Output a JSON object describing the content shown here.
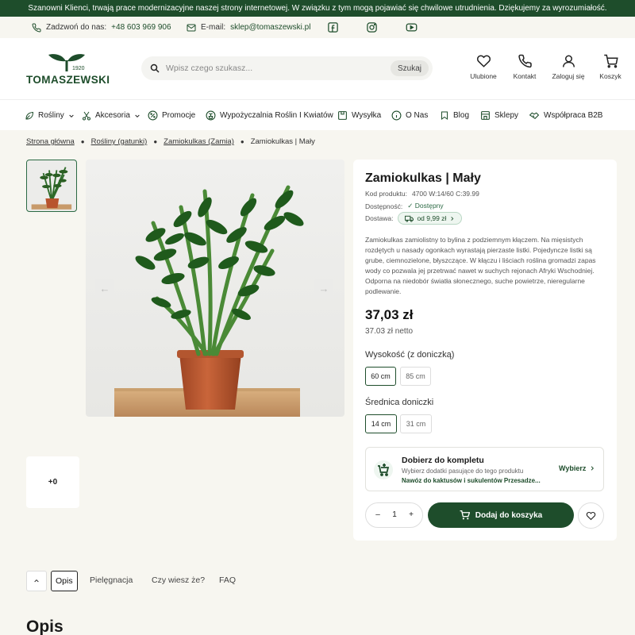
{
  "notice": "Szanowni Klienci, trwają prace modernizacyjne naszej strony internetowej. W związku z tym mogą pojawiać się chwilowe utrudnienia. Dziękujemy za wyrozumiałość.",
  "contact": {
    "phone_label": "Zadzwoń do nas:",
    "phone": "+48 603 969 906",
    "email_label": "E-mail:",
    "email": "sklep@tomaszewski.pl",
    "social_icons": [
      "facebook-icon",
      "instagram-icon",
      "youtube-icon"
    ]
  },
  "logo": {
    "text": "TOMASZEWSKI",
    "year": "1920"
  },
  "search": {
    "placeholder": "Wpisz czego szukasz...",
    "button": "Szukaj"
  },
  "header_icons": [
    {
      "label": "Ulubione",
      "icon": "heart-icon"
    },
    {
      "label": "Kontakt",
      "icon": "phone-icon"
    },
    {
      "label": "Zaloguj się",
      "icon": "user-icon"
    },
    {
      "label": "Koszyk",
      "icon": "cart-icon"
    }
  ],
  "nav": [
    {
      "label": "Rośliny",
      "icon": "leaf-icon",
      "dropdown": true
    },
    {
      "label": "Akcesoria",
      "icon": "scissors-icon",
      "dropdown": true
    },
    {
      "label": "Promocje",
      "icon": "percent-icon"
    },
    {
      "label": "Wypożyczalnia Roślin I Kwiatów",
      "icon": "plant-pot-icon"
    },
    {
      "label": "Wysyłka",
      "icon": "box-icon"
    },
    {
      "label": "O Nas",
      "icon": "info-icon"
    },
    {
      "label": "Blog",
      "icon": "bookmark-icon"
    },
    {
      "label": "Sklepy",
      "icon": "store-icon"
    },
    {
      "label": "Współpraca B2B",
      "icon": "handshake-icon"
    }
  ],
  "breadcrumb": [
    "Strona główna",
    "Rośliny (gatunki)",
    "Zamiokulkas (Zamia)",
    "Zamiokulkas | Mały"
  ],
  "gallery": {
    "more_label": "+0"
  },
  "product": {
    "title": "Zamiokulkas | Mały",
    "code_label": "Kod produktu:",
    "code": "4700 W:14/60 C:39.99",
    "availability_label": "Dostępność:",
    "availability": "Dostępny",
    "delivery_label": "Dostawa:",
    "delivery": "od 9,99 zł",
    "description": "Zamiokulkas zamiolistny to bylina z podziemnym kłączem. Na mięsistych rozdętych u nasady ogonkach wyrastają pierzaste listki. Pojedyncze listki są grube, ciemnozielone, błyszczące. W kłączu i liściach roślina gromadzi zapas wody co pozwala jej przetrwać nawet w suchych rejonach Afryki Wschodniej. Odporna na niedobór światła słonecznego, suche powietrze, nieregularne podlewanie.",
    "price": "37,03 zł",
    "price_net": "37.03 zł netto",
    "height_label": "Wysokość (z doniczką)",
    "height_options": [
      "60 cm",
      "85 cm"
    ],
    "height_selected": "60 cm",
    "diameter_label": "Średnica doniczki",
    "diameter_options": [
      "14 cm",
      "31 cm"
    ],
    "diameter_selected": "14 cm",
    "kit": {
      "title": "Dobierz do kompletu",
      "subtitle": "Wybierz dodatki pasujące do tego produktu",
      "links": "Nawóz do kaktusów i sukulentów   Przesadze...",
      "choose": "Wybierz"
    },
    "quantity": "1",
    "minus": "–",
    "plus": "+",
    "add_to_cart": "Dodaj do koszyka"
  },
  "tabs": [
    "Opis",
    "Pielęgnacja",
    "Czy wiesz że?",
    "FAQ"
  ],
  "active_tab": "Opis",
  "section_title": "Opis",
  "colors": {
    "brand": "#1e4d2b",
    "background": "#f7f6f0",
    "accent_light": "#eef6f0"
  }
}
